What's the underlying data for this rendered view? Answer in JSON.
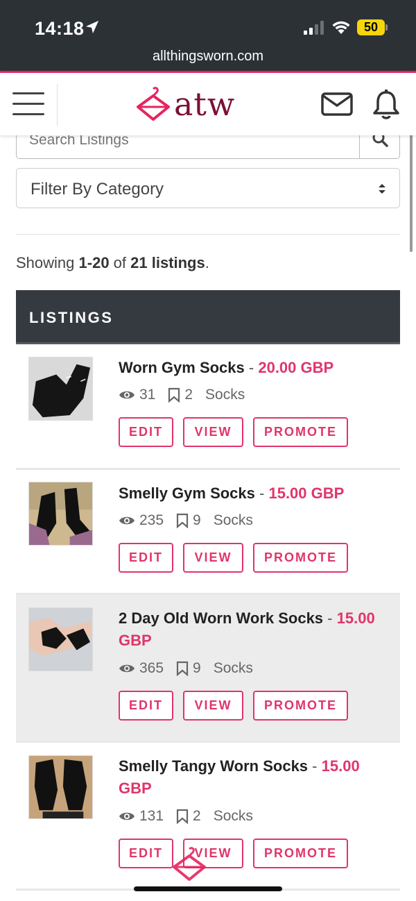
{
  "status": {
    "time": "14:18",
    "battery": "50",
    "url": "allthingsworn.com"
  },
  "header": {
    "logo_text": "atw"
  },
  "search": {
    "placeholder": "Search Listings"
  },
  "filter": {
    "label": "Filter By Category"
  },
  "summary": {
    "prefix": "Showing ",
    "range": "1-20",
    "middle": " of ",
    "total": "21 listings",
    "suffix": "."
  },
  "listings_header": "LISTINGS",
  "buttons": {
    "edit": "EDIT",
    "view": "VIEW",
    "promote": "PROMOTE"
  },
  "listings": [
    {
      "title": "Worn Gym Socks",
      "price": "20.00 GBP",
      "views": "31",
      "saves": "2",
      "category": "Socks"
    },
    {
      "title": "Smelly Gym Socks",
      "price": "15.00 GBP",
      "views": "235",
      "saves": "9",
      "category": "Socks"
    },
    {
      "title": "2 Day Old Worn Work Socks",
      "price": "15.00 GBP",
      "views": "365",
      "saves": "9",
      "category": "Socks"
    },
    {
      "title": "Smelly Tangy Worn Socks",
      "price": "15.00 GBP",
      "views": "131",
      "saves": "2",
      "category": "Socks"
    }
  ],
  "colors": {
    "accent": "#e0356a",
    "dark": "#343a40",
    "brand": "#7a1036"
  }
}
